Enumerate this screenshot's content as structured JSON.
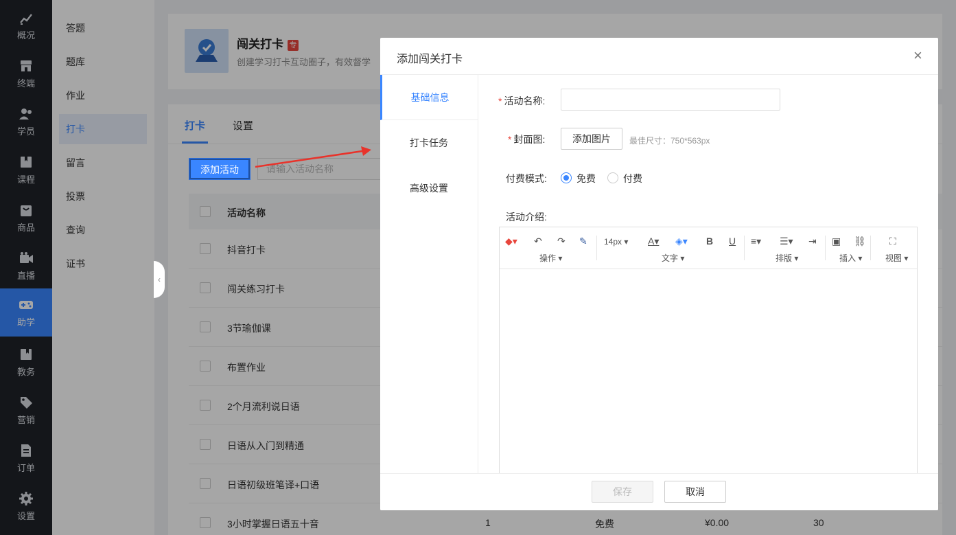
{
  "rail": {
    "items": [
      {
        "label": "概况",
        "icon": "chart-up-icon"
      },
      {
        "label": "终端",
        "icon": "shop-icon"
      },
      {
        "label": "学员",
        "icon": "users-icon"
      },
      {
        "label": "课程",
        "icon": "book-icon"
      },
      {
        "label": "商品",
        "icon": "bag-icon"
      },
      {
        "label": "直播",
        "icon": "video-icon"
      },
      {
        "label": "助学",
        "icon": "gamepad-icon"
      },
      {
        "label": "教务",
        "icon": "bookmark-icon"
      },
      {
        "label": "营销",
        "icon": "tag-icon"
      },
      {
        "label": "订单",
        "icon": "document-icon"
      },
      {
        "label": "设置",
        "icon": "gear-icon"
      }
    ],
    "active": "助学",
    "accent": "#3a86ff"
  },
  "subnav": {
    "items": [
      "答题",
      "题库",
      "作业",
      "打卡",
      "留言",
      "投票",
      "查询",
      "证书"
    ],
    "active": "打卡"
  },
  "hero": {
    "title": "闯关打卡",
    "badge": "专",
    "desc": "创建学习打卡互动圈子，有效督学"
  },
  "tabs": [
    "打卡",
    "设置"
  ],
  "toolbar_main": {
    "add_label": "添加活动",
    "search_placeholder": "请输入活动名称"
  },
  "table": {
    "header": "活动名称",
    "rows": [
      {
        "name": "抖音打卡"
      },
      {
        "name": "闯关练习打卡"
      },
      {
        "name": "3节瑜伽课"
      },
      {
        "name": "布置作业"
      },
      {
        "name": "2个月流利说日语"
      },
      {
        "name": "日语从入门到精通"
      },
      {
        "name": "日语初级班笔译+口语"
      },
      {
        "name": "3小时掌握日语五十音",
        "c2": "1",
        "c3": "免费",
        "c4": "¥0.00",
        "c5": "30"
      }
    ]
  },
  "modal": {
    "title": "添加闯关打卡",
    "close": "×",
    "side_tabs": [
      "基础信息",
      "打卡任务",
      "高级设置"
    ],
    "active_side_tab": "基础信息",
    "form": {
      "name_label": "活动名称:",
      "cover_label": "封面图:",
      "cover_button": "添加图片",
      "cover_hint": "最佳尺寸：750*563px",
      "pay_label": "付费模式:",
      "pay_options": [
        "免费",
        "付费"
      ],
      "pay_selected": "免费",
      "intro_label": "活动介绍:",
      "required_mark": "*"
    },
    "editor": {
      "font_size": "14px",
      "groups": [
        "操作",
        "文字",
        "排版",
        "插入",
        "视图"
      ]
    },
    "footer": {
      "save": "保存",
      "cancel": "取消"
    }
  }
}
